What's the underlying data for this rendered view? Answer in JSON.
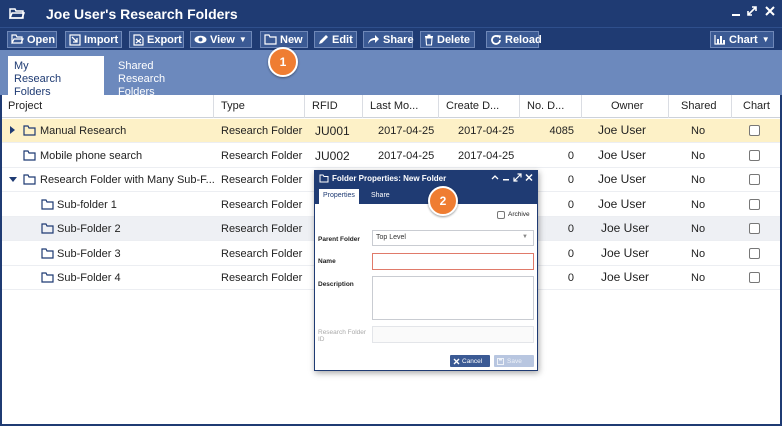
{
  "window": {
    "title": "Joe User's Research Folders",
    "controls": [
      "minimize-icon",
      "restore-icon",
      "maximize-icon",
      "close-icon"
    ]
  },
  "toolbar": {
    "open": "Open",
    "import": "Import",
    "export": "Export",
    "view": "View",
    "new": "New",
    "edit": "Edit",
    "share": "Share",
    "delete": "Delete",
    "reload": "Reload",
    "chart": "Chart"
  },
  "tabs": [
    {
      "line1": "My",
      "line2": "Research Folders",
      "active": true
    },
    {
      "line1": "Shared",
      "line2": "Research Folders",
      "active": false
    }
  ],
  "callouts": [
    "1",
    "2"
  ],
  "grid": {
    "columns": [
      "Project",
      "Type",
      "RFID",
      "Last Mo...",
      "Create D...",
      "No. D...",
      "Owner",
      "Shared",
      "Chart"
    ],
    "rows": [
      {
        "project": "Manual Research",
        "type": "Research Folder",
        "rfid": "JU001",
        "last_modified": "2017-04-25",
        "created": "2017-04-25",
        "docs": "4085",
        "owner": "Joe User",
        "shared": "No"
      },
      {
        "project": "Mobile phone search",
        "type": "Research Folder",
        "rfid": "JU002",
        "last_modified": "2017-04-25",
        "created": "2017-04-25",
        "docs": "0",
        "owner": "Joe User",
        "shared": "No"
      },
      {
        "project": "Research Folder with Many Sub-F...",
        "type": "Research Folder",
        "rfid": "",
        "last_modified": "",
        "created": "",
        "docs": "0",
        "owner": "Joe User",
        "shared": "No"
      },
      {
        "project": "Sub-folder 1",
        "type": "Research Folder",
        "rfid": "",
        "last_modified": "",
        "created": "",
        "docs": "0",
        "owner": "Joe User",
        "shared": "No"
      },
      {
        "project": "Sub-Folder 2",
        "type": "Research Folder",
        "rfid": "",
        "last_modified": "",
        "created": "",
        "docs": "0",
        "owner": "Joe User",
        "shared": "No"
      },
      {
        "project": "Sub-Folder 3",
        "type": "Research Folder",
        "rfid": "",
        "last_modified": "",
        "created": "",
        "docs": "0",
        "owner": "Joe User",
        "shared": "No"
      },
      {
        "project": "Sub-Folder 4",
        "type": "Research Folder",
        "rfid": "",
        "last_modified": "",
        "created": "",
        "docs": "0",
        "owner": "Joe User",
        "shared": "No"
      }
    ]
  },
  "dialog": {
    "title": "Folder Properties: New Folder",
    "tabs": [
      "Properties",
      "Share"
    ],
    "archive_label": "Archive",
    "parent_folder_label": "Parent Folder",
    "parent_folder_value": "Top Level",
    "name_label": "Name",
    "name_value": "",
    "description_label": "Description",
    "description_value": "",
    "research_folder_id_label_1": "Research Folder",
    "research_folder_id_label_2": "ID",
    "research_folder_id_value": "",
    "cancel": "Cancel",
    "save": "Save"
  },
  "colors": {
    "brand": "#1f3b73",
    "tabbar": "#6c89bd",
    "selected_row": "#fdf1c7",
    "callout": "#ef7d32",
    "name_field_border": "#e07a6a"
  }
}
